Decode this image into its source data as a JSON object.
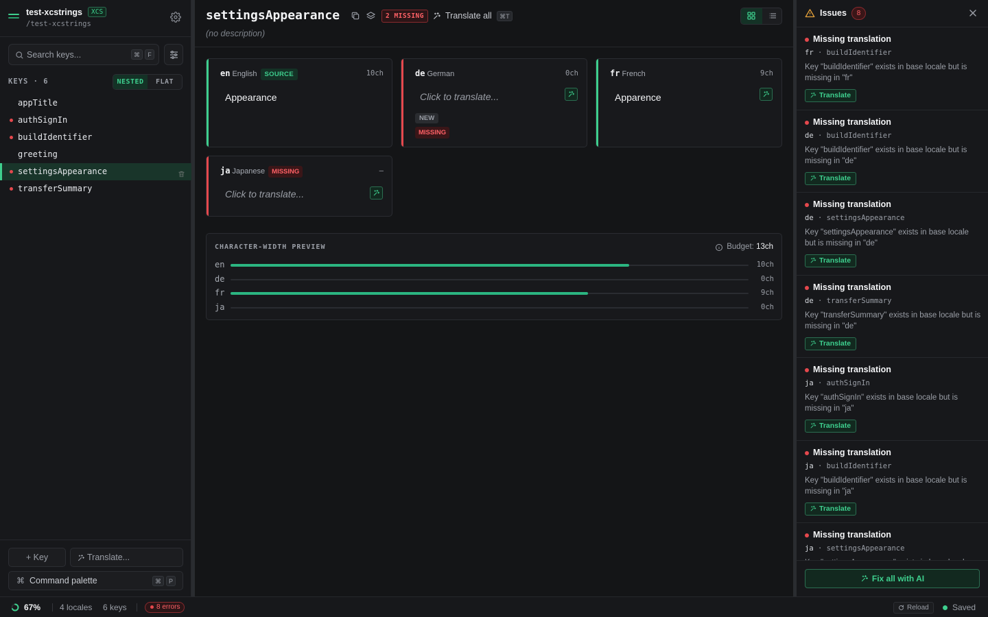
{
  "project": {
    "name": "test-xcstrings",
    "badge": "XCS",
    "path": "/test-xcstrings"
  },
  "search": {
    "placeholder": "Search keys...",
    "shortcut": [
      "⌘",
      "F"
    ]
  },
  "keys": {
    "label": "KEYS · 6",
    "view_modes": [
      "NESTED",
      "FLAT"
    ],
    "active_view_mode": "NESTED",
    "items": [
      {
        "name": "appTitle",
        "has_error": false,
        "selected": false
      },
      {
        "name": "authSignIn",
        "has_error": true,
        "selected": false
      },
      {
        "name": "buildIdentifier",
        "has_error": true,
        "selected": false
      },
      {
        "name": "greeting",
        "has_error": false,
        "selected": false
      },
      {
        "name": "settingsAppearance",
        "has_error": true,
        "selected": true
      },
      {
        "name": "transferSummary",
        "has_error": true,
        "selected": false
      }
    ]
  },
  "sidebar_footer": {
    "add_key_label": "+ Key",
    "translate_label": "Translate...",
    "command_palette_label": "Command palette",
    "command_palette_icon": "⌘",
    "command_palette_shortcut": [
      "⌘",
      "P"
    ]
  },
  "editor": {
    "key": "settingsAppearance",
    "missing_badge": "2 MISSING",
    "translate_all_label": "Translate all",
    "translate_all_shortcut": "⌘T",
    "description": "(no description)",
    "locales": [
      {
        "code": "en",
        "name": "English",
        "source_label": "SOURCE",
        "char_count": "10ch",
        "value": "Appearance",
        "status": "source",
        "stripe_color": "#3ecf8e"
      },
      {
        "code": "de",
        "name": "German",
        "char_count": "0ch",
        "placeholder": "Click to translate...",
        "status": "missing",
        "tags": [
          "NEW",
          "MISSING"
        ],
        "stripe_color": "#e5484d"
      },
      {
        "code": "fr",
        "name": "French",
        "char_count": "9ch",
        "value": "Apparence",
        "status": "translated",
        "stripe_color": "#3ecf8e"
      },
      {
        "code": "ja",
        "name": "Japanese",
        "missing_label": "MISSING",
        "char_count": "–",
        "placeholder": "Click to translate...",
        "status": "missing",
        "stripe_color": "#e5484d"
      }
    ]
  },
  "char_preview": {
    "title": "CHARACTER-WIDTH PREVIEW",
    "budget_label": "Budget:",
    "budget_value": "13ch",
    "rows": [
      {
        "code": "en",
        "value": "10ch",
        "fill_fraction": 0.77
      },
      {
        "code": "de",
        "value": "0ch",
        "fill_fraction": 0
      },
      {
        "code": "fr",
        "value": "9ch",
        "fill_fraction": 0.69
      },
      {
        "code": "ja",
        "value": "0ch",
        "fill_fraction": 0
      }
    ]
  },
  "issues": {
    "title": "Issues",
    "count": "8",
    "translate_label": "Translate",
    "fix_all_label": "Fix all with AI",
    "items": [
      {
        "title": "Missing translation",
        "locale": "fr",
        "key": "buildIdentifier",
        "message": "Key \"buildIdentifier\" exists in base locale but is missing in \"fr\""
      },
      {
        "title": "Missing translation",
        "locale": "de",
        "key": "buildIdentifier",
        "message": "Key \"buildIdentifier\" exists in base locale but is missing in \"de\""
      },
      {
        "title": "Missing translation",
        "locale": "de",
        "key": "settingsAppearance",
        "message": "Key \"settingsAppearance\" exists in base locale but is missing in \"de\""
      },
      {
        "title": "Missing translation",
        "locale": "de",
        "key": "transferSummary",
        "message": "Key \"transferSummary\" exists in base locale but is missing in \"de\""
      },
      {
        "title": "Missing translation",
        "locale": "ja",
        "key": "authSignIn",
        "message": "Key \"authSignIn\" exists in base locale but is missing in \"ja\""
      },
      {
        "title": "Missing translation",
        "locale": "ja",
        "key": "buildIdentifier",
        "message": "Key \"buildIdentifier\" exists in base locale but is missing in \"ja\""
      },
      {
        "title": "Missing translation",
        "locale": "ja",
        "key": "settingsAppearance",
        "message": "Key \"settingsAppearance\" exists in base locale but is missing in \"ja\""
      }
    ]
  },
  "status_bar": {
    "progress": "67%",
    "progress_fraction": 0.67,
    "locales": "4 locales",
    "keys": "6 keys",
    "errors": "8 errors",
    "reload_label": "Reload",
    "save_status": "Saved"
  },
  "colors": {
    "accent": "#3ecf8e",
    "error": "#e5484d",
    "warning": "#e8a33a",
    "background": "#141517"
  }
}
